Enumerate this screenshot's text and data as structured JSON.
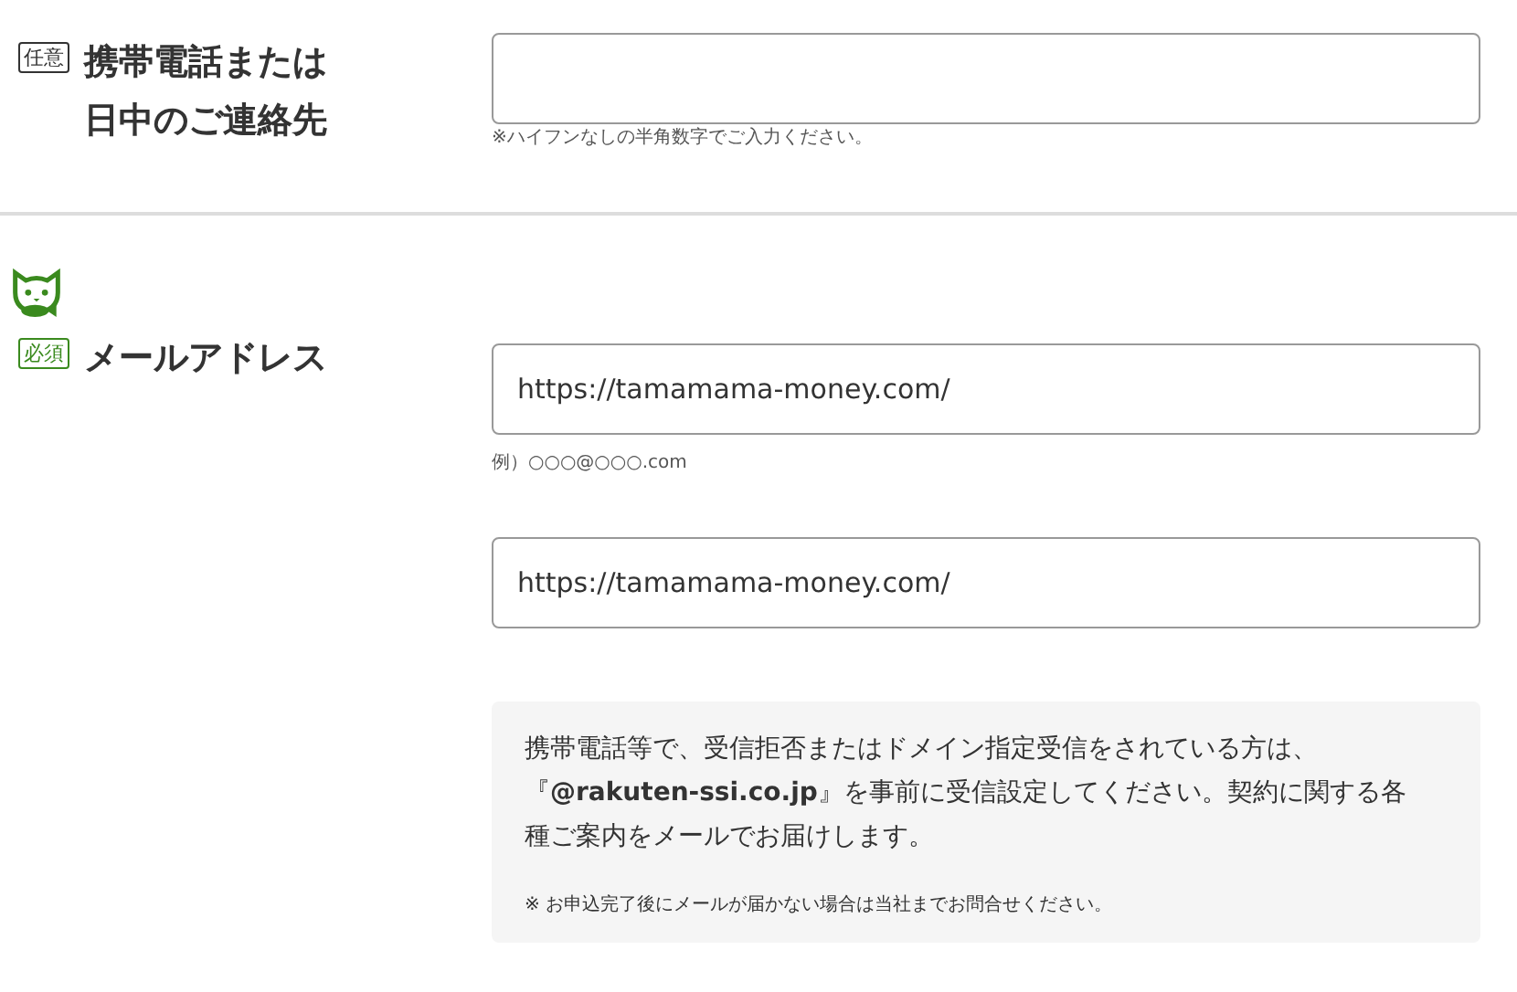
{
  "sections": [
    {
      "badge": {
        "kind": "optional",
        "text": "任意"
      },
      "label_lines": [
        "携帯電話または",
        "日中のご連絡先"
      ],
      "mascot": false,
      "fields": [
        {
          "hint": "※ハイフンなしの半角数字でご入力ください。"
        }
      ]
    },
    {
      "badge": {
        "kind": "required",
        "text": "必須"
      },
      "label_lines": [
        "メールアドレス"
      ],
      "mascot": true,
      "fields": [
        {
          "value": "https://tamamama-money.com/",
          "hint": "例）○○○@○○○.com"
        },
        {
          "value": "https://tamamama-money.com/"
        }
      ],
      "notice": {
        "text": "携帯電話等で、受信拒否またはドメイン指定受信をされている方は、『**@rakuten-ssi.co.jp**』を事前に受信設定してください。契約に関する各種ご案内をメールでお届けします。",
        "note": "※ お申込完了後にメールが届かない場合は当社までお問合せください。"
      }
    }
  ]
}
